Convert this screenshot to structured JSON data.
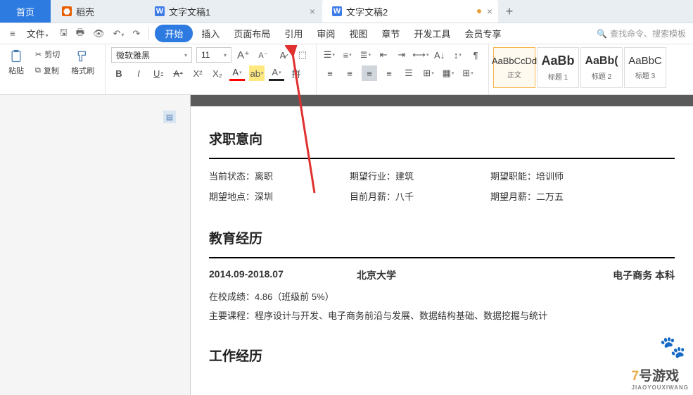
{
  "tabs": {
    "home": "首页",
    "doke": "稻壳",
    "doc1": "文字文稿1",
    "doc2": "文字文稿2"
  },
  "menu": {
    "file": "文件",
    "start": "开始",
    "insert": "插入",
    "layout": "页面布局",
    "ref": "引用",
    "review": "审阅",
    "view": "视图",
    "chapter": "章节",
    "dev": "开发工具",
    "vip": "会员专享"
  },
  "search": {
    "ph": "查找命令、搜索模板"
  },
  "tb": {
    "paste": "粘贴",
    "cut": "剪切",
    "copy": "复制",
    "brush": "格式刷",
    "font": "微软雅黑",
    "size": "11"
  },
  "styles": {
    "s1p": "AaBbCcDd",
    "s1": "正文",
    "s2p": "AaBb",
    "s2": "标题 1",
    "s3p": "AaBb(",
    "s3": "标题 2",
    "s4p": "AaBbC",
    "s4": "标题 3"
  },
  "doc": {
    "sec1": "求职意向",
    "r1a": "当前状态：离职",
    "r1b": "期望行业：建筑",
    "r1c": "期望职能：培训师",
    "r2a": "期望地点：深圳",
    "r2b": "目前月薪：八千",
    "r2c": "期望月薪：二万五",
    "sec2": "教育经历",
    "e1a": "2014.09-2018.07",
    "e1b": "北京大学",
    "e1c": "电子商务  本科",
    "e2": "在校成绩：4.86（班级前 5%）",
    "e3": "主要课程：程序设计与开发、电子商务前沿与发展、数据结构基础、数据挖掘与统计",
    "sec3": "工作经历"
  },
  "wm": {
    "t": "7号游戏",
    "s": "JIAOYOUXIWANG"
  }
}
